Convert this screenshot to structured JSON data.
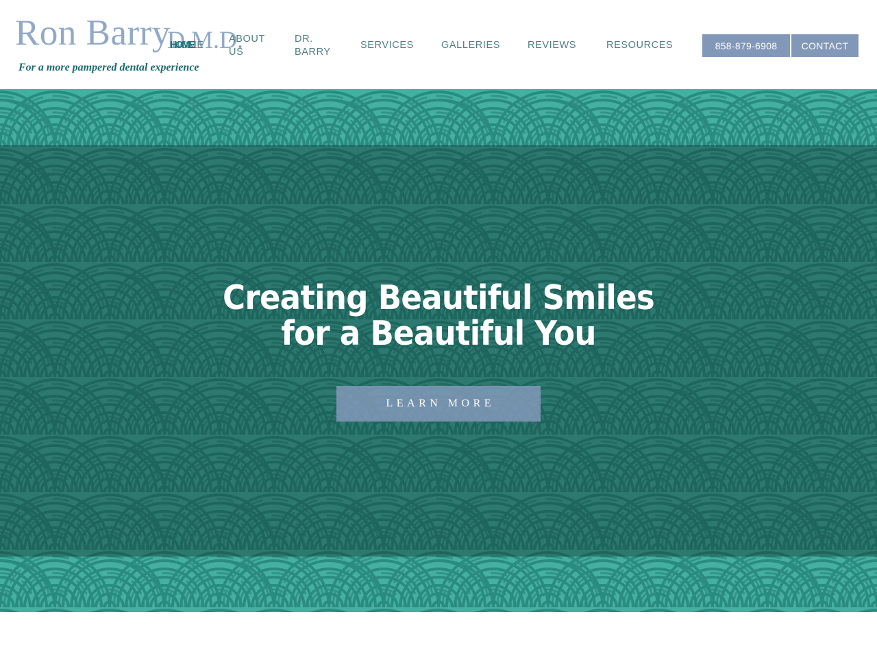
{
  "theme": {
    "brand_blue": "#92a9c6",
    "teal_dark": "#1c6b6d",
    "nav_teal": "#4d7f85",
    "button_slate": "#8298b9",
    "wave_light": "#45b0a1",
    "wave_stroke": "#2a8b80",
    "overlay_dark": "#2f6259",
    "white": "#ffffff"
  },
  "header": {
    "brand": {
      "name": "Ron Barry",
      "credential": "D.M.D.",
      "tagline": "For a more pampered dental experience"
    },
    "nav": [
      {
        "id": "home",
        "label": "HOME"
      },
      {
        "id": "about-us",
        "label": "ABOUT\nUS"
      },
      {
        "id": "dr-barry",
        "label": "DR.\nBARRY"
      },
      {
        "id": "services",
        "label": "SERVICES"
      },
      {
        "id": "galleries",
        "label": "GALLERIES"
      },
      {
        "id": "reviews",
        "label": "REVIEWS"
      },
      {
        "id": "resources",
        "label": "RESOURCES"
      }
    ],
    "actions": {
      "phone": "858-879-6908",
      "contact": "CONTACT"
    }
  },
  "hero": {
    "title": "Creating Beautiful Smiles for a Beautiful You",
    "cta_label": "LEARN MORE",
    "background": "teal-wave-pattern"
  }
}
